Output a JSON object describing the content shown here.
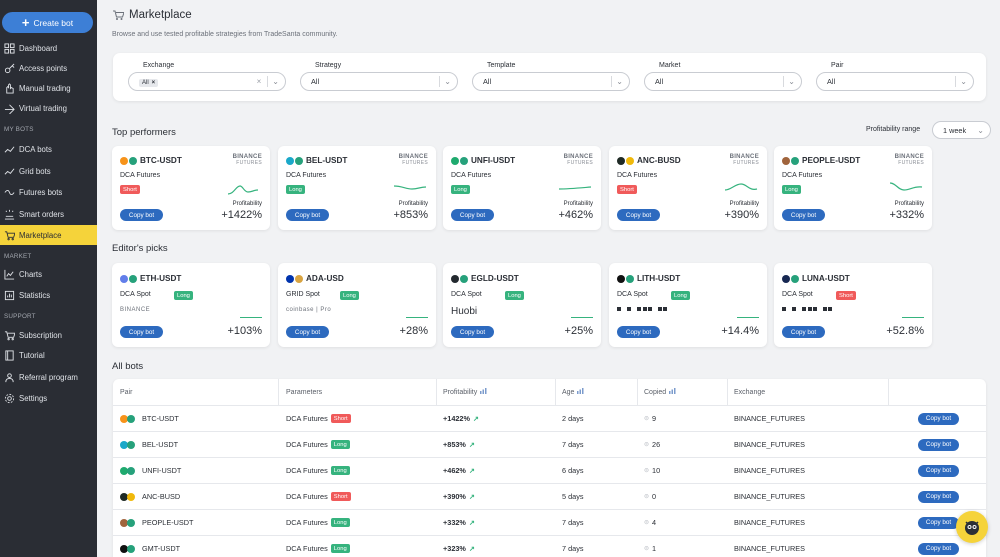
{
  "sidebar": {
    "create_label": "Create bot",
    "items_top": [
      {
        "label": "Dashboard",
        "icon": "grid-icon"
      },
      {
        "label": "Access points",
        "icon": "key-icon"
      },
      {
        "label": "Manual trading",
        "icon": "hand-icon"
      },
      {
        "label": "Virtual trading",
        "icon": "virtual-icon"
      }
    ],
    "section_bots": "MY BOTS",
    "items_bots": [
      {
        "label": "DCA bots",
        "icon": "chart-line-icon"
      },
      {
        "label": "Grid bots",
        "icon": "chart-line-icon"
      },
      {
        "label": "Futures bots",
        "icon": "futures-icon"
      },
      {
        "label": "Smart orders",
        "icon": "smart-orders-icon"
      },
      {
        "label": "Marketplace",
        "icon": "cart-icon"
      }
    ],
    "section_market": "MARKET",
    "items_market": [
      {
        "label": "Charts",
        "icon": "charts-icon"
      },
      {
        "label": "Statistics",
        "icon": "statistics-icon"
      }
    ],
    "section_support": "SUPPORT",
    "items_support": [
      {
        "label": "Subscription",
        "icon": "cart-icon"
      },
      {
        "label": "Tutorial",
        "icon": "book-icon"
      },
      {
        "label": "Referral program",
        "icon": "referral-icon"
      },
      {
        "label": "Settings",
        "icon": "gear-icon"
      }
    ]
  },
  "header": {
    "title": "Marketplace",
    "subtitle": "Browse and use tested profitable strategies from TradeSanta community."
  },
  "filters": [
    {
      "label": "Exchange",
      "chip": "All",
      "value": ""
    },
    {
      "label": "Strategy",
      "value": "All"
    },
    {
      "label": "Template",
      "value": "All"
    },
    {
      "label": "Market",
      "value": "All"
    },
    {
      "label": "Pair",
      "value": "All"
    }
  ],
  "top": {
    "title": "Top performers",
    "range_label": "Profitability range",
    "range_value": "1 week",
    "profit_label": "Profitability",
    "copy_label": "Copy bot",
    "cards": [
      {
        "pair": "BTC-USDT",
        "strategy": "DCA Futures",
        "side": "Short",
        "profit": "+1422%",
        "ex1": "BINANCE",
        "ex2": "FUTURES",
        "c1": "#f7931a",
        "c2": "#26a17b"
      },
      {
        "pair": "BEL-USDT",
        "strategy": "DCA Futures",
        "side": "Long",
        "profit": "+853%",
        "ex1": "BINANCE",
        "ex2": "FUTURES",
        "c1": "#1aa8c9",
        "c2": "#26a17b"
      },
      {
        "pair": "UNFI-USDT",
        "strategy": "DCA Futures",
        "side": "Long",
        "profit": "+462%",
        "ex1": "BINANCE",
        "ex2": "FUTURES",
        "c1": "#1faa6e",
        "c2": "#26a17b"
      },
      {
        "pair": "ANC-BUSD",
        "strategy": "DCA Futures",
        "side": "Short",
        "profit": "+390%",
        "ex1": "BINANCE",
        "ex2": "FUTURES",
        "c1": "#1f2a25",
        "c2": "#f0b90b"
      },
      {
        "pair": "PEOPLE-USDT",
        "strategy": "DCA Futures",
        "side": "Long",
        "profit": "+332%",
        "ex1": "BINANCE",
        "ex2": "FUTURES",
        "c1": "#a0643c",
        "c2": "#26a17b"
      }
    ]
  },
  "picks": {
    "title": "Editor's picks",
    "cards": [
      {
        "pair": "ETH-USDT",
        "strategy": "DCA Spot",
        "side": "Long",
        "profit": "+103%",
        "exchange": "BINANCE",
        "c1": "#627eea",
        "c2": "#26a17b"
      },
      {
        "pair": "ADA-USD",
        "strategy": "GRID Spot",
        "side": "Long",
        "profit": "+28%",
        "exchange": "coinbase | Pro",
        "c1": "#0033ad",
        "c2": "#d9a441"
      },
      {
        "pair": "EGLD-USDT",
        "strategy": "DCA Spot",
        "side": "Long",
        "profit": "+25%",
        "exchange": "Huobi",
        "c1": "#23292f",
        "c2": "#26a17b"
      },
      {
        "pair": "LITH-USDT",
        "strategy": "DCA Spot",
        "side": "Long",
        "profit": "+14.4%",
        "exchange": "OKX",
        "c1": "#111111",
        "c2": "#26a17b"
      },
      {
        "pair": "LUNA-USDT",
        "strategy": "DCA Spot",
        "side": "Short",
        "profit": "+52.8%",
        "exchange": "OKX",
        "c1": "#172852",
        "c2": "#26a17b"
      }
    ]
  },
  "all_bots": {
    "title": "All bots",
    "columns": [
      "Pair",
      "Parameters",
      "Profitability",
      "Age",
      "Copied",
      "Exchange"
    ],
    "rows": [
      {
        "pair": "BTC-USDT",
        "params": "DCA Futures",
        "side": "Short",
        "profit": "+1422%",
        "age": "2 days",
        "copied": "9",
        "exchange": "BINANCE_FUTURES",
        "c1": "#f7931a",
        "c2": "#26a17b"
      },
      {
        "pair": "BEL-USDT",
        "params": "DCA Futures",
        "side": "Long",
        "profit": "+853%",
        "age": "7 days",
        "copied": "26",
        "exchange": "BINANCE_FUTURES",
        "c1": "#1aa8c9",
        "c2": "#26a17b"
      },
      {
        "pair": "UNFI-USDT",
        "params": "DCA Futures",
        "side": "Long",
        "profit": "+462%",
        "age": "6 days",
        "copied": "10",
        "exchange": "BINANCE_FUTURES",
        "c1": "#1faa6e",
        "c2": "#26a17b"
      },
      {
        "pair": "ANC-BUSD",
        "params": "DCA Futures",
        "side": "Short",
        "profit": "+390%",
        "age": "5 days",
        "copied": "0",
        "exchange": "BINANCE_FUTURES",
        "c1": "#1f2a25",
        "c2": "#f0b90b"
      },
      {
        "pair": "PEOPLE-USDT",
        "params": "DCA Futures",
        "side": "Long",
        "profit": "+332%",
        "age": "7 days",
        "copied": "4",
        "exchange": "BINANCE_FUTURES",
        "c1": "#a0643c",
        "c2": "#26a17b"
      },
      {
        "pair": "GMT-USDT",
        "params": "DCA Futures",
        "side": "Long",
        "profit": "+323%",
        "age": "7 days",
        "copied": "1",
        "exchange": "BINANCE_FUTURES",
        "c1": "#111111",
        "c2": "#26a17b"
      }
    ]
  }
}
